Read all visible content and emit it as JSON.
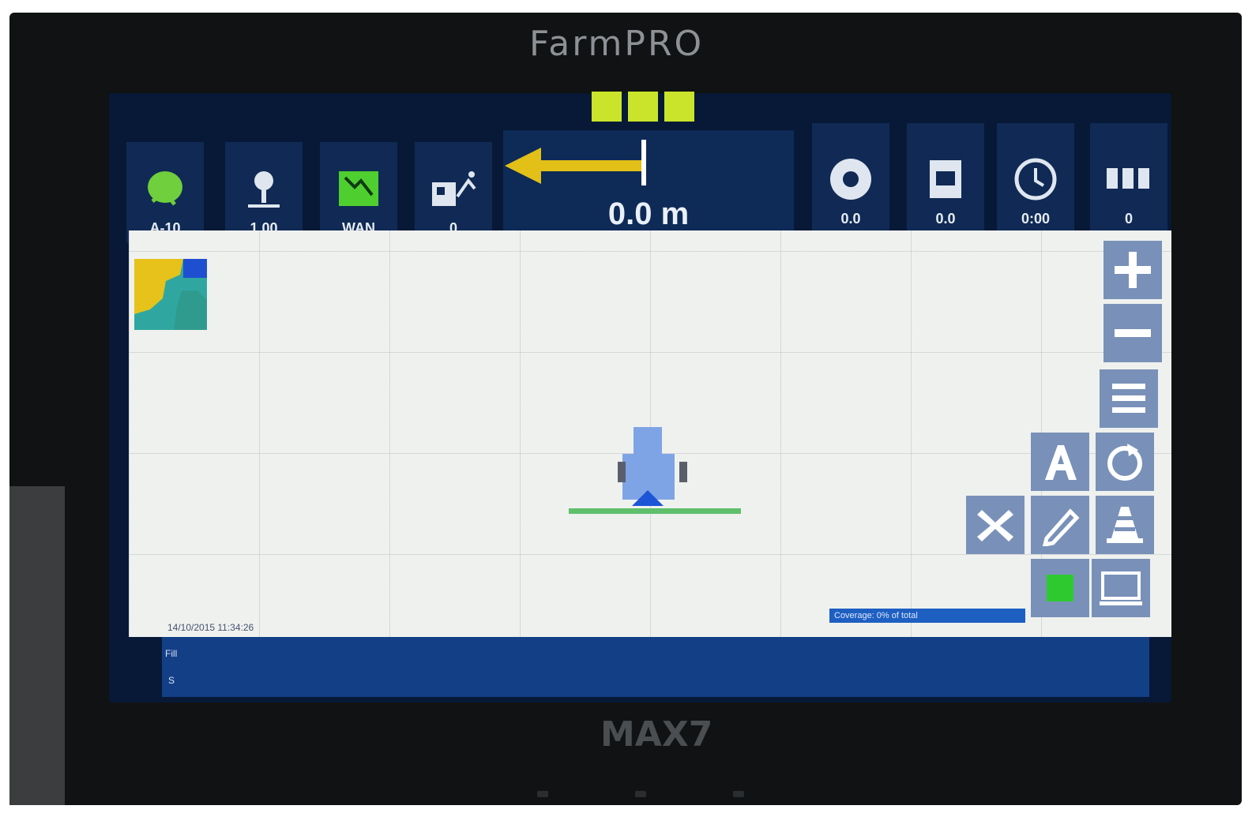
{
  "device": {
    "brand": "FarmPRO",
    "model": "MAX7"
  },
  "status_indicators": [
    "#c9e42a",
    "#c9e42a",
    "#c9e42a"
  ],
  "top_left_tiles": [
    {
      "icon": "satellite-icon",
      "value": "A-10"
    },
    {
      "icon": "gps-antenna-icon",
      "value": "1.00"
    },
    {
      "icon": "field-map-icon",
      "value": "WAN"
    },
    {
      "icon": "implement-icon",
      "value": "0"
    }
  ],
  "guidance": {
    "value": "0.0 m",
    "arrow_direction": "left",
    "arrow_color": "#e2c018"
  },
  "top_right_tiles": [
    {
      "icon": "speedometer-icon",
      "value": "0.0"
    },
    {
      "icon": "area-icon",
      "value": "0.0"
    },
    {
      "icon": "timer-icon",
      "value": "0:00"
    },
    {
      "icon": "sections-icon",
      "value": "0"
    }
  ],
  "map": {
    "timestamp": "14/10/2015 11:34:26",
    "coverage_status": "Coverage: 0% of total",
    "boom_color": "#5fbf6b",
    "vehicle_color": "#7fa4e6"
  },
  "controls": {
    "zoom_in": "+",
    "zoom_out": "−",
    "menu": "≡",
    "auto_steer": "A",
    "cancel": "X"
  },
  "bottom_strip": {
    "line1": "Fill",
    "line2": "S"
  },
  "colors": {
    "screen_bg": "#071936",
    "tile_bg": "#102a55",
    "control_bg": "#7991b8",
    "map_bg": "#eff1ef",
    "accent": "#c9e42a"
  }
}
